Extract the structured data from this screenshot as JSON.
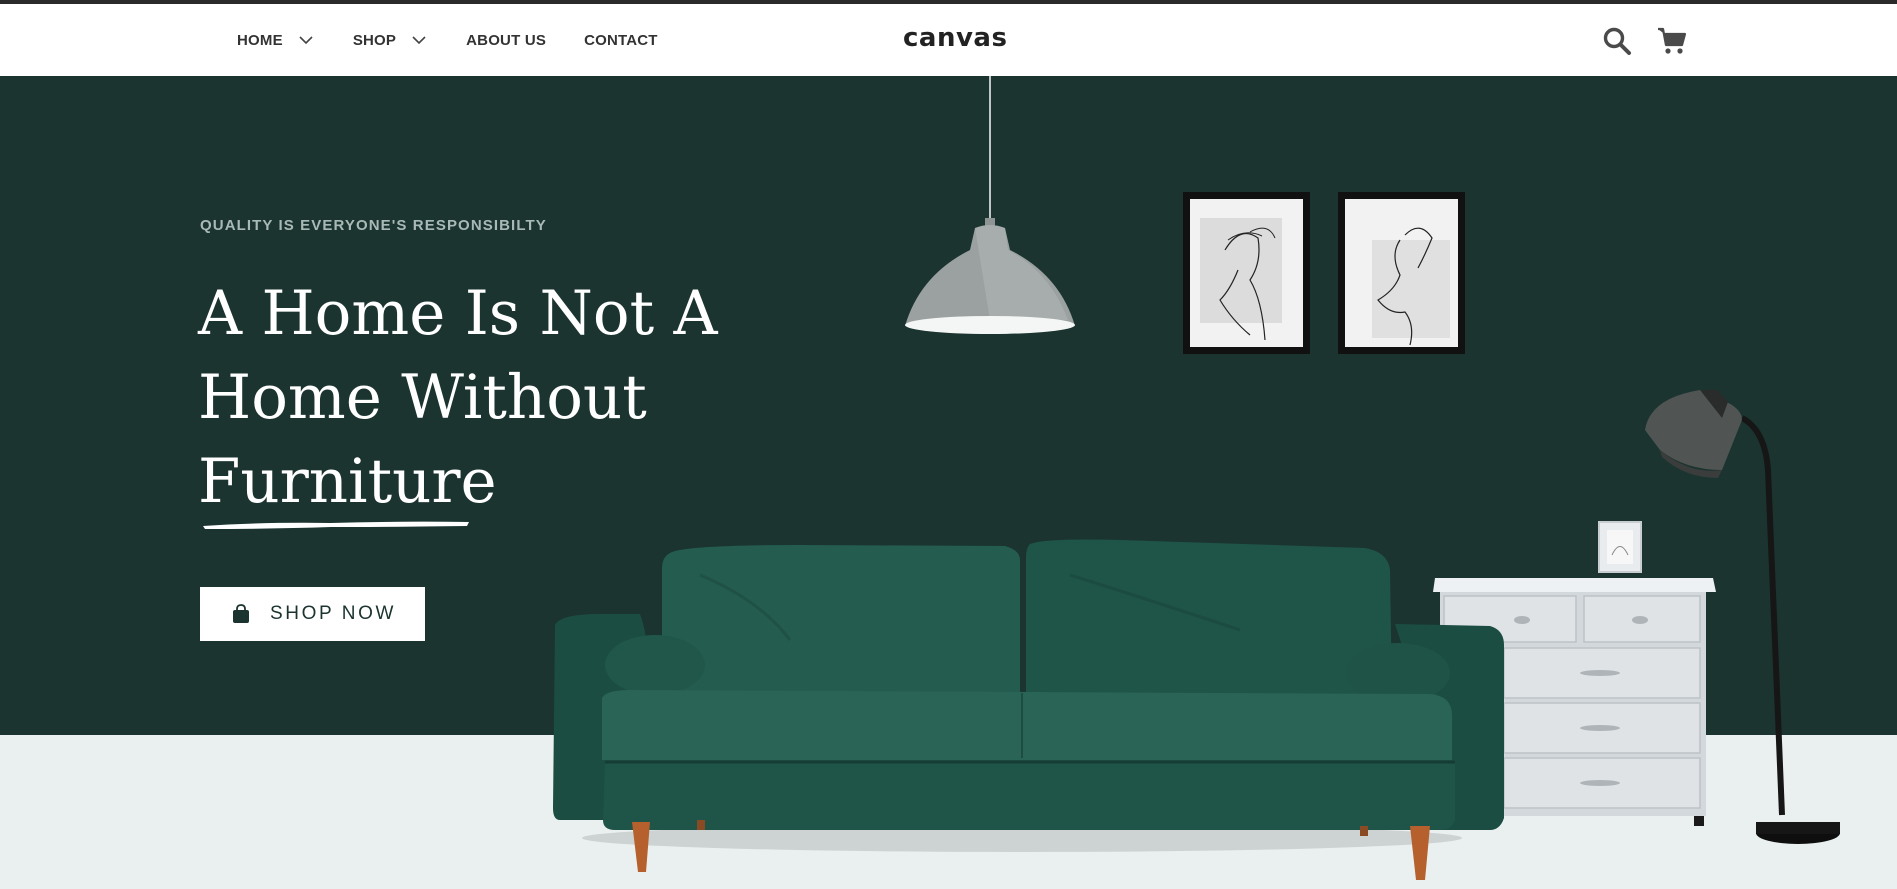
{
  "header": {
    "logo": "canvas",
    "nav": [
      {
        "label": "HOME",
        "has_dropdown": true
      },
      {
        "label": "SHOP",
        "has_dropdown": true
      },
      {
        "label": "ABOUT US",
        "has_dropdown": false
      },
      {
        "label": "CONTACT",
        "has_dropdown": false
      }
    ],
    "icons": [
      "search-icon",
      "cart-icon"
    ]
  },
  "hero": {
    "eyebrow": "QUALITY IS EVERYONE'S RESPONSIBILTY",
    "headline_lines": [
      "A Home Is Not A",
      "Home Without",
      "Furniture"
    ],
    "cta_label": "SHOP NOW",
    "cta_icon": "shopping-bag-icon"
  },
  "colors": {
    "hero_bg": "#1b3430",
    "floor_bg": "#eaf0f0",
    "sofa": "#1e5247",
    "text_light": "#ffffff",
    "eyebrow": "#a9bab6"
  }
}
